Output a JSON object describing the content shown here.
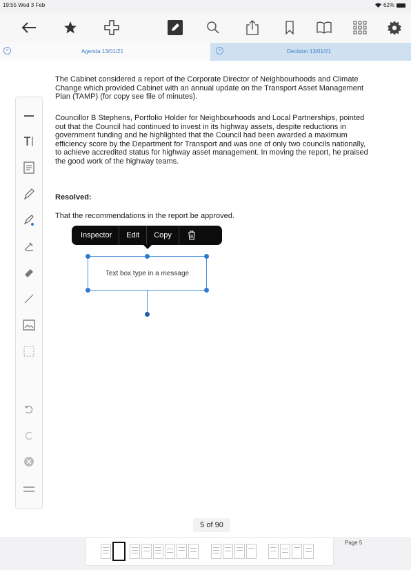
{
  "status": {
    "time": "19:55",
    "date": "Wed 3 Feb",
    "battery": "62%"
  },
  "toolbar": {
    "icons": [
      "back-arrow-icon",
      "star-icon",
      "move-icon",
      "edit-icon",
      "search-icon",
      "share-icon",
      "bookmark-icon",
      "book-icon",
      "grid-icon",
      "gear-icon"
    ]
  },
  "tabs": [
    {
      "label": "Agenda 13/01/21",
      "close": "×"
    },
    {
      "label": "Decision 13/01/21",
      "close": "×"
    }
  ],
  "document": {
    "para1": "The Cabinet considered a report of the Corporate Director of Neighbourhoods and Climate Change which provided Cabinet with an annual update on the Transport Asset Management Plan (TAMP) (for copy see file of minutes).",
    "para2": "Councillor B Stephens, Portfolio Holder for Neighbourhoods and Local Partnerships, pointed out that the Council had continued to invest in its highway assets, despite reductions in government funding and he highlighted that the Council had been awarded a maximum efficiency score by the Department for Transport and was one of only two councils nationally, to achieve accredited status for highway asset management.  In moving the report, he praised the good work of the highway teams.",
    "resolved_heading": "Resolved:",
    "para3": "That the recommendations in the report be approved."
  },
  "context_menu": {
    "inspector": "Inspector",
    "edit": "Edit",
    "copy": "Copy"
  },
  "textbox": {
    "text": "Text box type in a message"
  },
  "page_indicator": "5 of 90",
  "page_label": "Page 5",
  "colors": {
    "accent": "#2f7ad1",
    "tab_active_bg": "#cfe1f1",
    "menu_bg": "#0c0c0c"
  }
}
